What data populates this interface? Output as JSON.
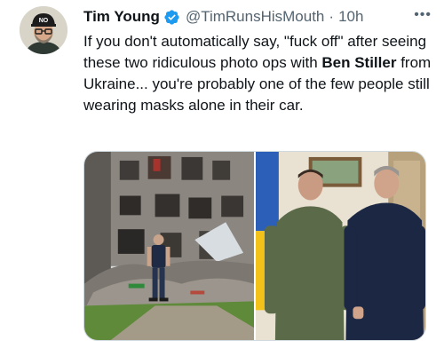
{
  "tweet": {
    "author_name": "Tim Young",
    "author_handle": "@TimRunsHisMouth",
    "separator": "·",
    "timestamp": "10h",
    "more_icon": "more-icon",
    "verified_icon": "verified-badge-icon",
    "text_parts": [
      "If you don't automatically say, \"fuck off\" after seeing these two ridiculous photo ops with ",
      "Ben Stiller",
      " from Ukraine... you're probably one of the few people still wearing masks alone in their car."
    ],
    "avatar_cap_text": "NO",
    "colors": {
      "verified": "#1d9bf0",
      "secondary_text": "#536471",
      "primary_text": "#0f1419"
    }
  },
  "media": {
    "photos": [
      {
        "name": "destroyed-building-photo"
      },
      {
        "name": "two-men-posing-photo"
      }
    ]
  }
}
